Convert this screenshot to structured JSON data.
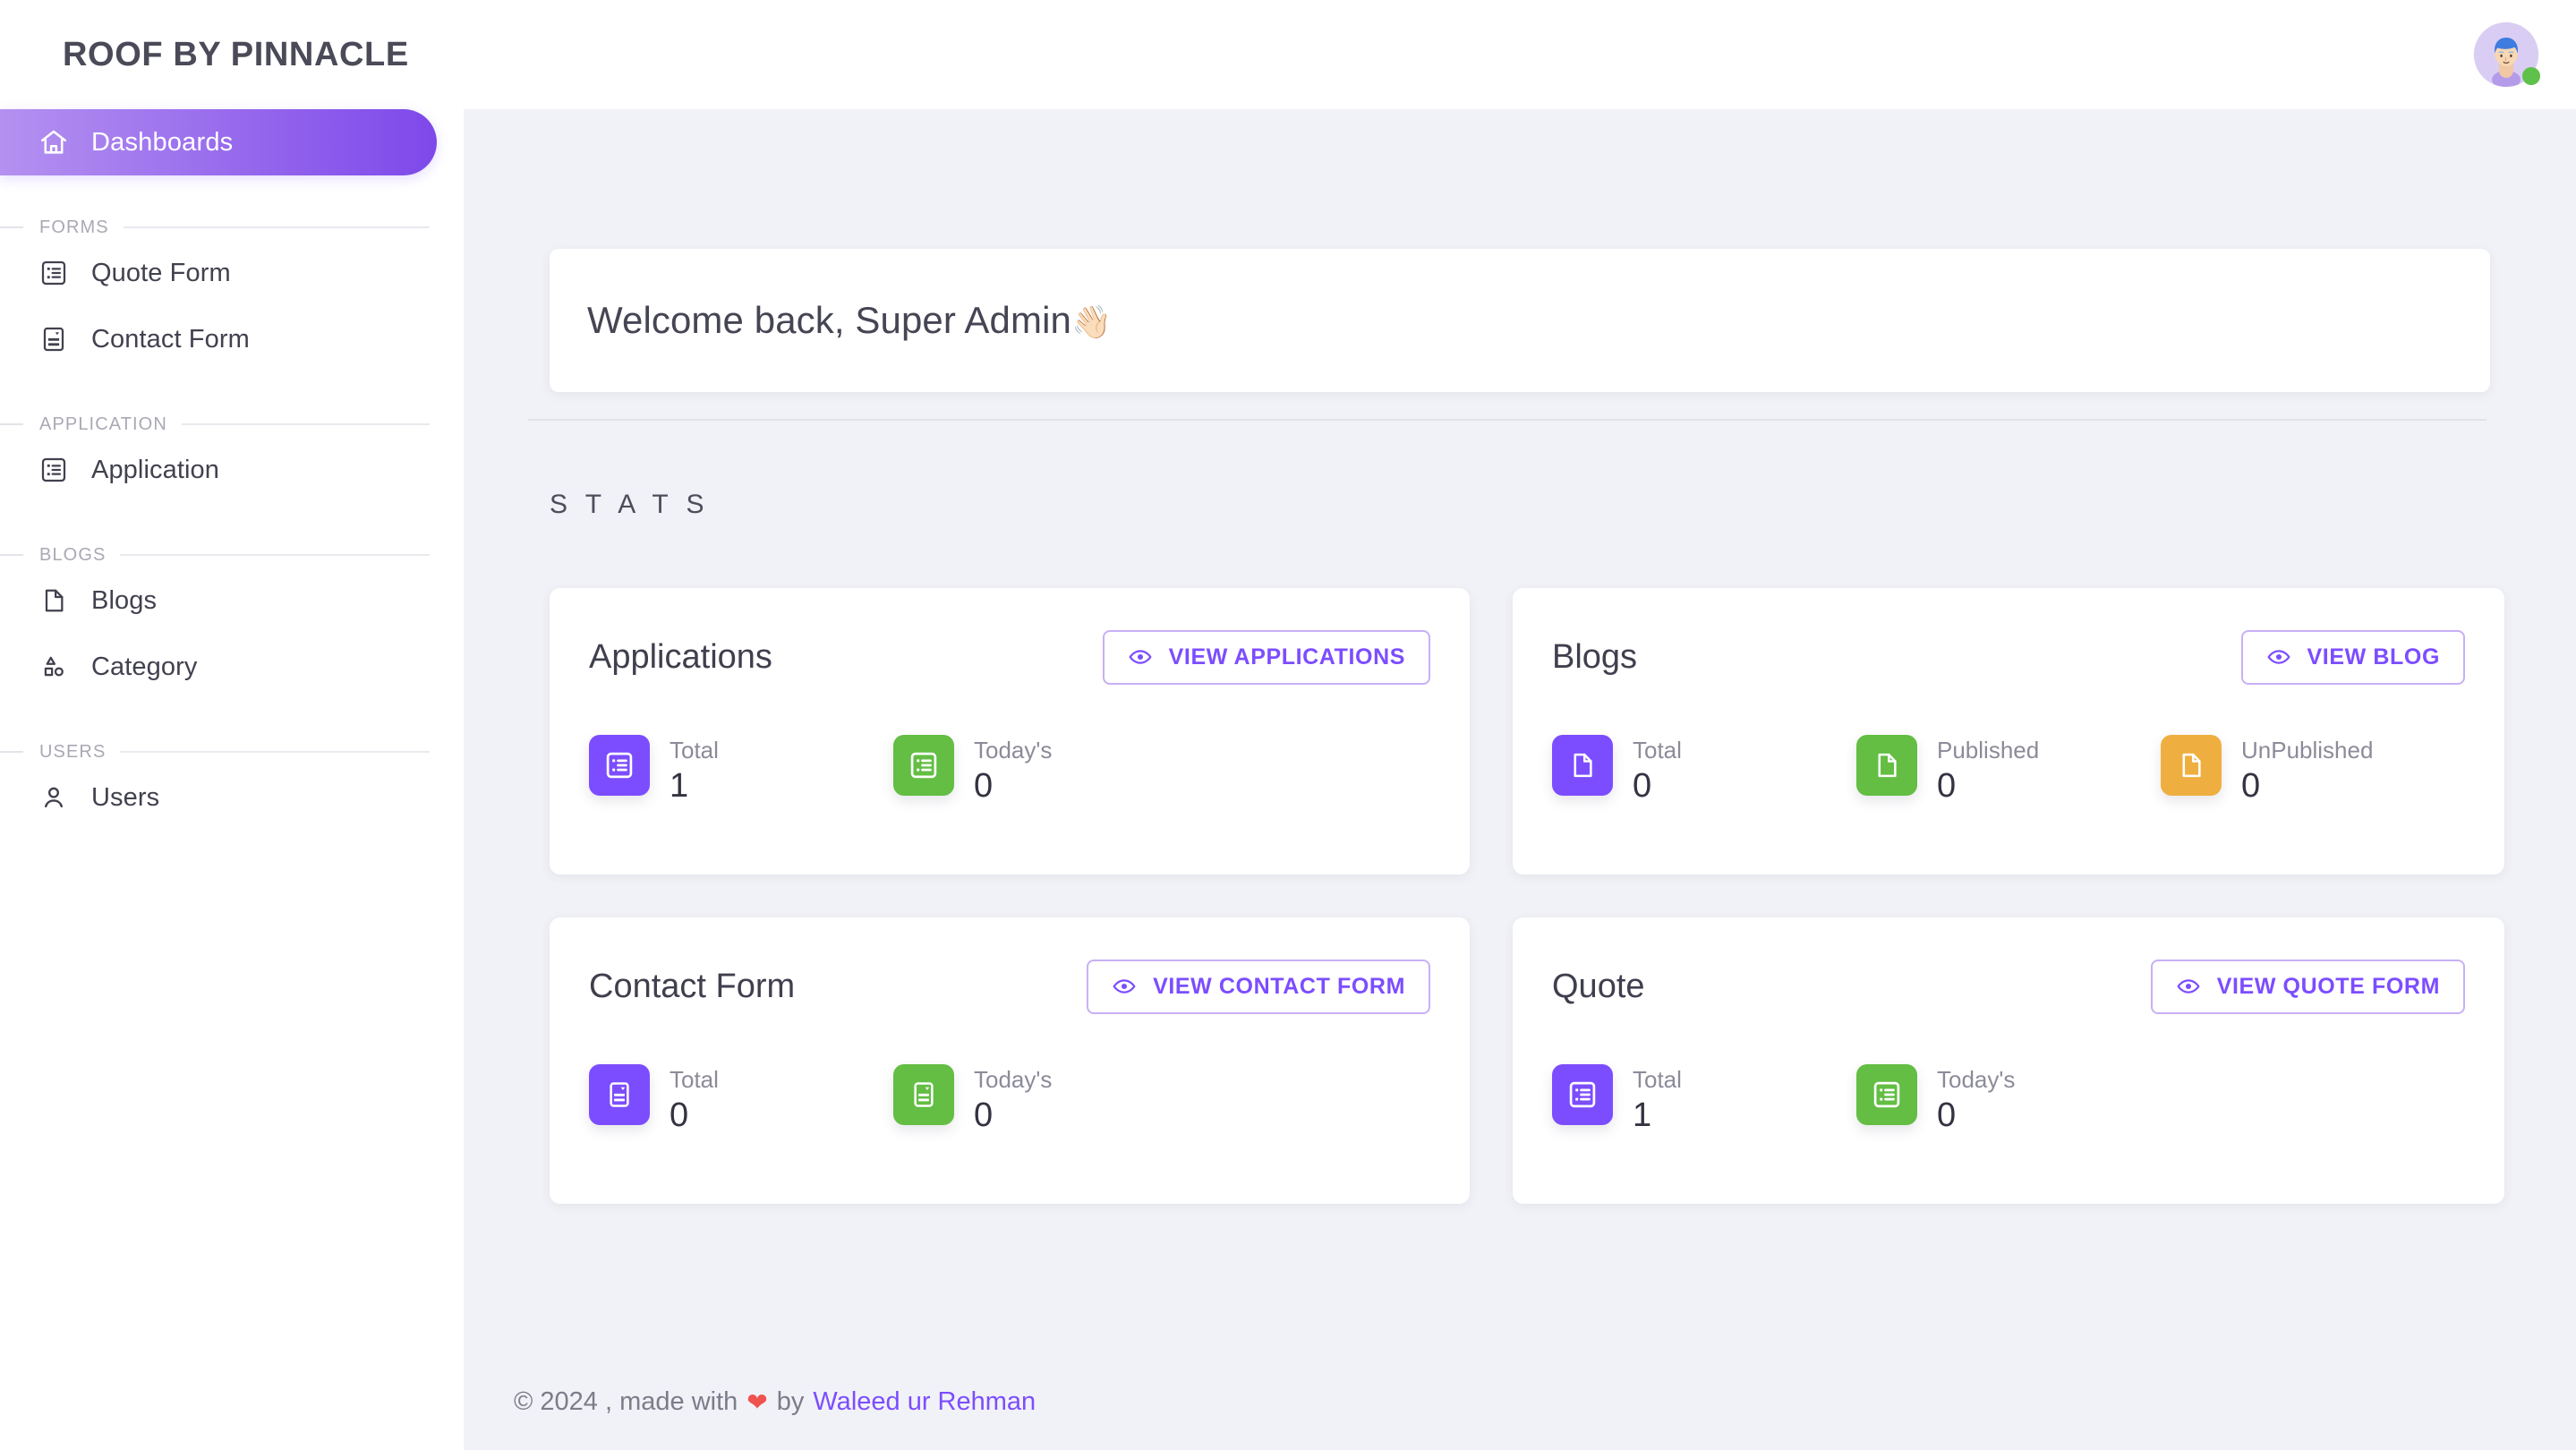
{
  "brand": {
    "title": "ROOF BY PINNACLE"
  },
  "sidebar": {
    "active_item": {
      "label": "Dashboards",
      "icon": "home-icon"
    },
    "sections": [
      {
        "label": "FORMS",
        "items": [
          {
            "label": "Quote Form",
            "icon": "list-box-icon"
          },
          {
            "label": "Contact Form",
            "icon": "form-document-icon"
          }
        ]
      },
      {
        "label": "APPLICATION",
        "items": [
          {
            "label": "Application",
            "icon": "list-box-icon"
          }
        ]
      },
      {
        "label": "BLOGS",
        "items": [
          {
            "label": "Blogs",
            "icon": "file-icon"
          },
          {
            "label": "Category",
            "icon": "shapes-icon"
          }
        ]
      },
      {
        "label": "USERS",
        "items": [
          {
            "label": "Users",
            "icon": "person-icon"
          }
        ]
      }
    ]
  },
  "topbar": {
    "avatar": {
      "name": "avatar",
      "status": "online",
      "status_color": "#5fc04a"
    }
  },
  "welcome": {
    "text": "Welcome back, Super Admin",
    "emoji": "👋🏻"
  },
  "stats_heading": "S T A T S",
  "cards": [
    {
      "title": "Applications",
      "button": {
        "label": "VIEW APPLICATIONS",
        "icon": "eye-icon"
      },
      "metrics": [
        {
          "label": "Total",
          "value": "1",
          "color": "#7c4dff",
          "icon": "list-box-icon"
        },
        {
          "label": "Today's",
          "value": "0",
          "color": "#63be43",
          "icon": "list-box-icon"
        }
      ]
    },
    {
      "title": "Blogs",
      "button": {
        "label": "VIEW BLOG",
        "icon": "eye-icon"
      },
      "metrics": [
        {
          "label": "Total",
          "value": "0",
          "color": "#7c4dff",
          "icon": "file-icon"
        },
        {
          "label": "Published",
          "value": "0",
          "color": "#63be43",
          "icon": "file-icon"
        },
        {
          "label": "UnPublished",
          "value": "0",
          "color": "#efaf40",
          "icon": "file-icon"
        }
      ]
    },
    {
      "title": "Contact Form",
      "button": {
        "label": "VIEW CONTACT FORM",
        "icon": "eye-icon"
      },
      "metrics": [
        {
          "label": "Total",
          "value": "0",
          "color": "#7c4dff",
          "icon": "form-document-icon"
        },
        {
          "label": "Today's",
          "value": "0",
          "color": "#63be43",
          "icon": "form-document-icon"
        }
      ]
    },
    {
      "title": "Quote",
      "button": {
        "label": "VIEW QUOTE FORM",
        "icon": "eye-icon"
      },
      "metrics": [
        {
          "label": "Total",
          "value": "1",
          "color": "#7c4dff",
          "icon": "list-box-icon"
        },
        {
          "label": "Today's",
          "value": "0",
          "color": "#63be43",
          "icon": "list-box-icon"
        }
      ]
    }
  ],
  "footer": {
    "copyright": "© 2024 , made with",
    "heart": "❤",
    "by": "by",
    "author": "Waleed ur Rehman"
  },
  "colors": {
    "accent": "#7c4dff",
    "accent_light": "#b491f0",
    "green": "#63be43",
    "orange": "#efaf40",
    "page_bg": "#f1f2f7",
    "heart": "#ef5350"
  }
}
